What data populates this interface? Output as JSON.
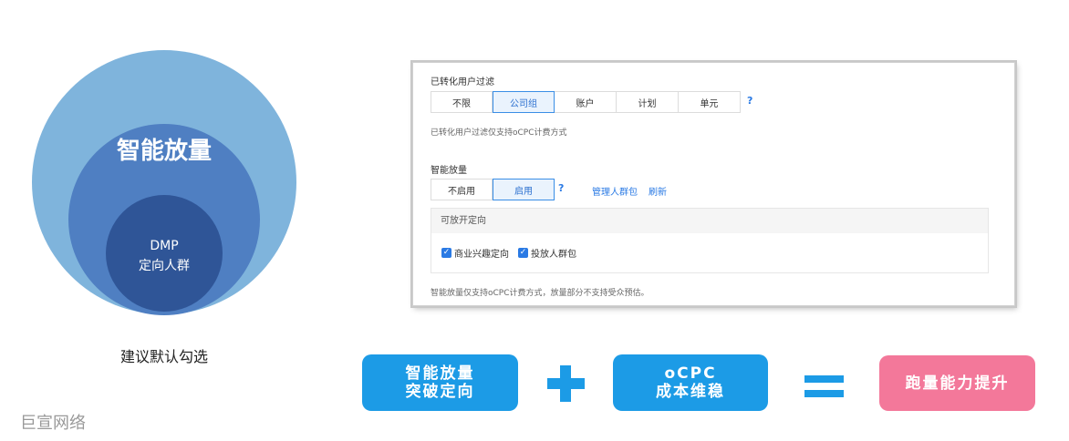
{
  "venn": {
    "outer_label": "智能放量",
    "inner_line1": "DMP",
    "inner_line2": "定向人群",
    "caption": "建议默认勾选"
  },
  "brand": "巨宣网络",
  "panel": {
    "filter_title": "已转化用户过滤",
    "filter_options": [
      "不限",
      "公司组",
      "账户",
      "计划",
      "单元"
    ],
    "filter_selected": "公司组",
    "filter_help": "?",
    "filter_note": "已转化用户过滤仅支持oCPC计费方式",
    "smart_title": "智能放量",
    "smart_options": [
      "不启用",
      "启用"
    ],
    "smart_selected": "启用",
    "smart_help": "?",
    "manage_link": "管理人群包",
    "refresh_link": "刷新",
    "targeting_header": "可放开定向",
    "checkboxes": [
      {
        "label": "商业兴趣定向",
        "checked": true
      },
      {
        "label": "投放人群包",
        "checked": true
      }
    ],
    "footer_note": "智能放量仅支持oCPC计费方式，放量部分不支持受众预估。"
  },
  "formula": {
    "pill1_line1": "智能放量",
    "pill1_line2": "突破定向",
    "pill2_line1": "oCPC",
    "pill2_line2": "成本维稳",
    "result": "跑量能力提升"
  },
  "colors": {
    "circle_outer": "#7fb4dc",
    "circle_mid": "#4f7fc2",
    "circle_inner": "#2f5597",
    "accent_blue": "#1c9be6",
    "result_pink": "#f3789a"
  }
}
